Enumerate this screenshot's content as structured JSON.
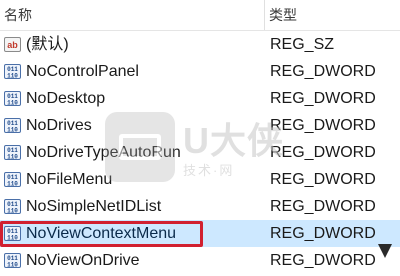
{
  "columns": {
    "name": "名称",
    "type": "类型"
  },
  "rows": [
    {
      "icon": "string-value-icon",
      "name": "(默认)",
      "type": "REG_SZ",
      "selected": false
    },
    {
      "icon": "dword-value-icon",
      "name": "NoControlPanel",
      "type": "REG_DWORD",
      "selected": false
    },
    {
      "icon": "dword-value-icon",
      "name": "NoDesktop",
      "type": "REG_DWORD",
      "selected": false
    },
    {
      "icon": "dword-value-icon",
      "name": "NoDrives",
      "type": "REG_DWORD",
      "selected": false
    },
    {
      "icon": "dword-value-icon",
      "name": "NoDriveTypeAutoRun",
      "type": "REG_DWORD",
      "selected": false
    },
    {
      "icon": "dword-value-icon",
      "name": "NoFileMenu",
      "type": "REG_DWORD",
      "selected": false
    },
    {
      "icon": "dword-value-icon",
      "name": "NoSimpleNetIDList",
      "type": "REG_DWORD",
      "selected": false
    },
    {
      "icon": "dword-value-icon",
      "name": "NoViewContextMenu",
      "type": "REG_DWORD",
      "selected": true
    },
    {
      "icon": "dword-value-icon",
      "name": "NoViewOnDrive",
      "type": "REG_DWORD",
      "selected": false
    }
  ],
  "watermark": {
    "title": "U大侠",
    "subtitle": "技术·网"
  },
  "colors": {
    "selection_bg": "#cde8ff",
    "highlight_border": "#d12030"
  }
}
